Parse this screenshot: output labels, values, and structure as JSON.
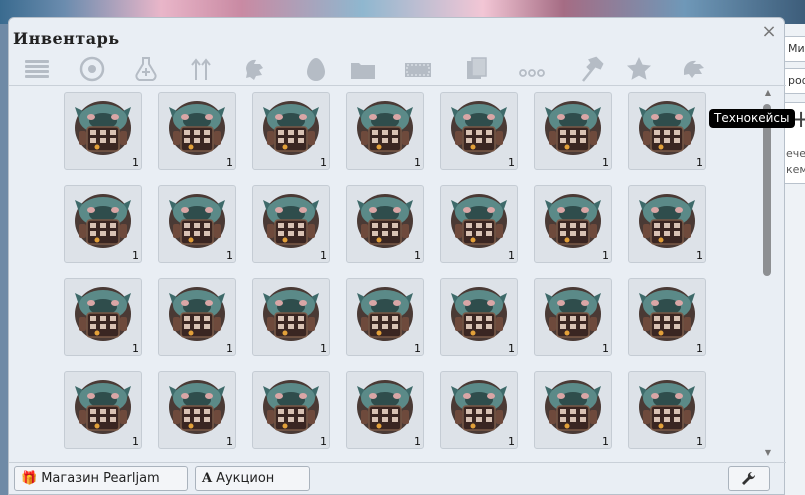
{
  "window": {
    "title": "Инвентарь",
    "close_glyph": "×"
  },
  "filters": [
    {
      "name": "filter-all-icon"
    },
    {
      "name": "filter-pokeball-icon"
    },
    {
      "name": "filter-potion-icon"
    },
    {
      "name": "filter-evolution-icon"
    },
    {
      "name": "filter-held-item-icon"
    },
    {
      "name": "filter-egg-icon"
    },
    {
      "name": "filter-folder-icon"
    },
    {
      "name": "filter-ticket-icon"
    },
    {
      "name": "filter-cards-icon"
    },
    {
      "name": "filter-more-icon"
    },
    {
      "name": "filter-hammer-icon"
    },
    {
      "name": "filter-star-icon"
    },
    {
      "name": "filter-technocase-icon"
    }
  ],
  "tooltip": "Технокейсы",
  "grid": {
    "item_name": "technocase-icon",
    "quantity": "1",
    "rows": 4,
    "cols": 7
  },
  "footer": {
    "shop_label": "Магазин Pearljam",
    "auction_label": "Аукцион",
    "auction_icon": "A",
    "shop_icon": "gift-icon",
    "settings_icon": "wrench-icon"
  },
  "side_panel": {
    "tab1": "Мис",
    "tab2": "роф",
    "btn_plus": "+",
    "btn_text1": "ечен",
    "btn_text2": "кемо"
  },
  "colors": {
    "window_bg": "#e9eef4",
    "slot_bg": "#dde2e8",
    "tooltip_bg": "#000000"
  }
}
